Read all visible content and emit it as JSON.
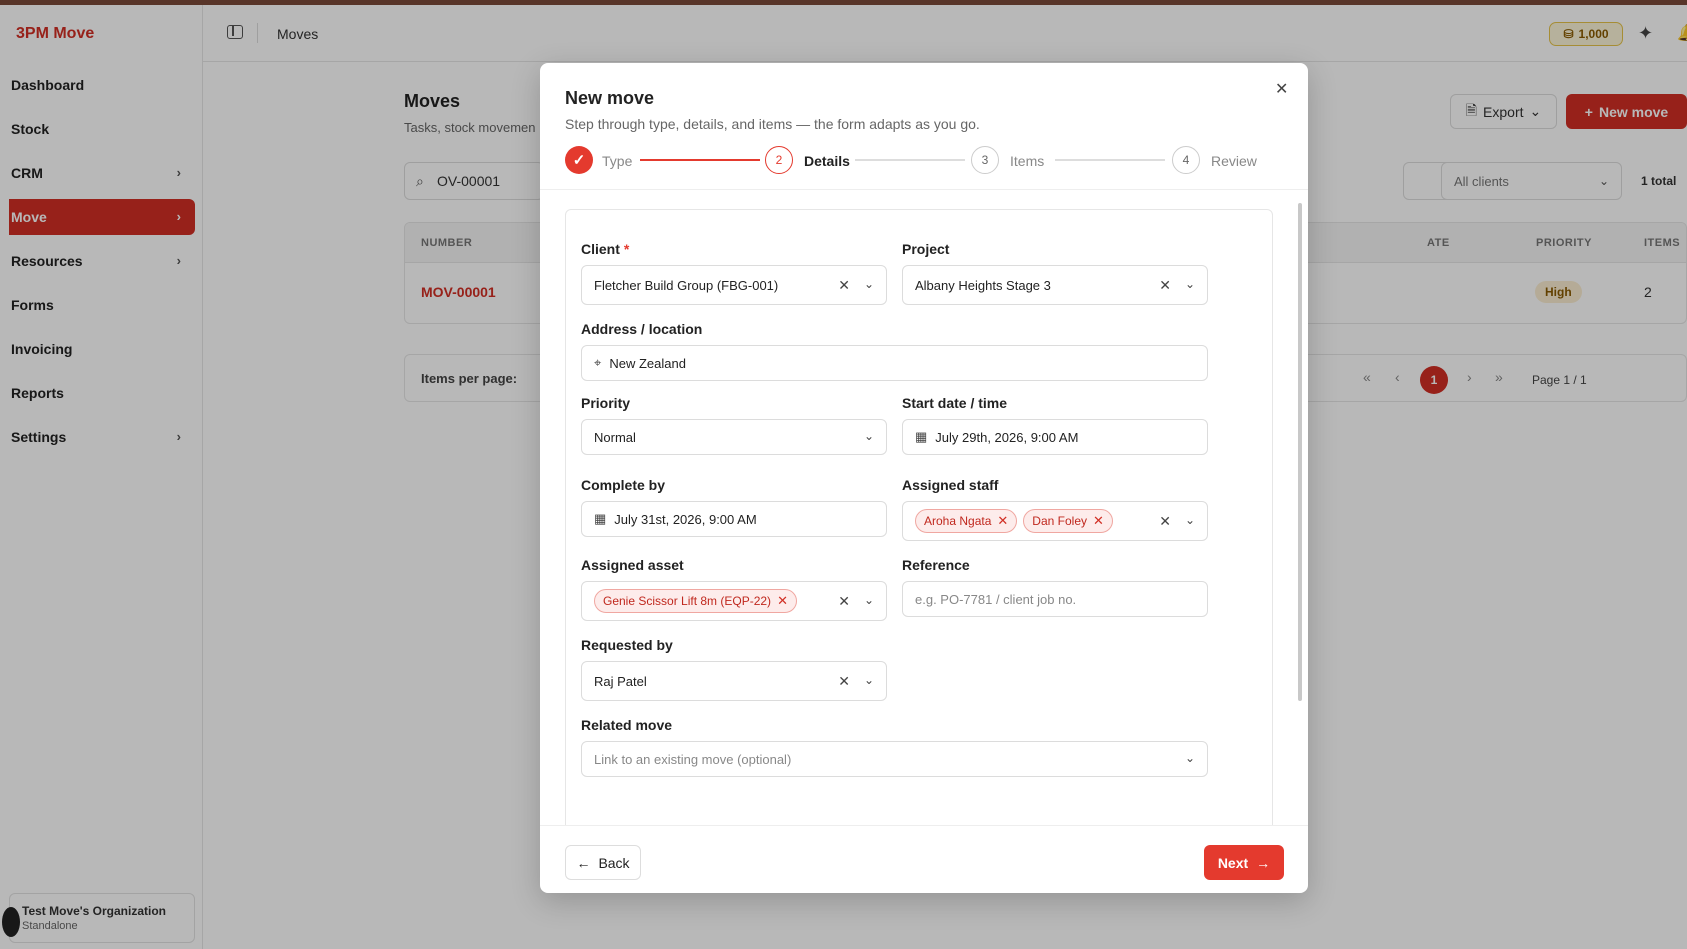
{
  "app": {
    "brand": "3PM Move",
    "header_title": "Moves",
    "credits": "1,000"
  },
  "sidebar": {
    "items": [
      {
        "label": "Dashboard"
      },
      {
        "label": "Stock"
      },
      {
        "label": "CRM"
      },
      {
        "label": "Move"
      },
      {
        "label": "Resources"
      },
      {
        "label": "Forms"
      },
      {
        "label": "Invoicing"
      },
      {
        "label": "Reports"
      },
      {
        "label": "Settings"
      }
    ],
    "org": {
      "name": "Test Move's Organization",
      "plan": "Standalone"
    }
  },
  "page": {
    "title": "Moves",
    "subtitle": "Tasks, stock movemen",
    "export_label": "Export",
    "new_label": "New move",
    "search_value": "OV-00001",
    "client_filter": "All clients",
    "total": "1 total",
    "table": {
      "headers": {
        "number": "NUMBER",
        "date": "ATE",
        "priority": "PRIORITY",
        "items": "ITEMS"
      },
      "rows": [
        {
          "number": "MOV-00001",
          "priority": "High",
          "items": "2"
        }
      ]
    },
    "pager": {
      "items_per_page": "Items per page:",
      "current": "1",
      "page_label": "Page 1 / 1"
    }
  },
  "modal": {
    "title": "New move",
    "subtitle": "Step through type, details, and items — the form adapts as you go.",
    "steps": [
      {
        "num": "1",
        "label": "Type"
      },
      {
        "num": "2",
        "label": "Details"
      },
      {
        "num": "3",
        "label": "Items"
      },
      {
        "num": "4",
        "label": "Review"
      }
    ],
    "fields": {
      "client": {
        "label": "Client",
        "value": "Fletcher Build Group (FBG-001)"
      },
      "project": {
        "label": "Project",
        "value": "Albany Heights Stage 3"
      },
      "address": {
        "label": "Address / location",
        "value": "New Zealand"
      },
      "priority": {
        "label": "Priority",
        "value": "Normal"
      },
      "start": {
        "label": "Start date / time",
        "value": "July 29th, 2026, 9:00 AM"
      },
      "complete": {
        "label": "Complete by",
        "value": "July 31st, 2026, 9:00 AM"
      },
      "staff": {
        "label": "Assigned staff",
        "chips": [
          "Aroha Ngata",
          "Dan Foley"
        ]
      },
      "asset": {
        "label": "Assigned asset",
        "chips": [
          "Genie Scissor Lift 8m (EQP-22)"
        ]
      },
      "reference": {
        "label": "Reference",
        "placeholder": "e.g. PO-7781 / client job no."
      },
      "requested_by": {
        "label": "Requested by",
        "value": "Raj Patel"
      },
      "related": {
        "label": "Related move",
        "placeholder": "Link to an existing move (optional)"
      }
    },
    "back_label": "Back",
    "next_label": "Next"
  }
}
